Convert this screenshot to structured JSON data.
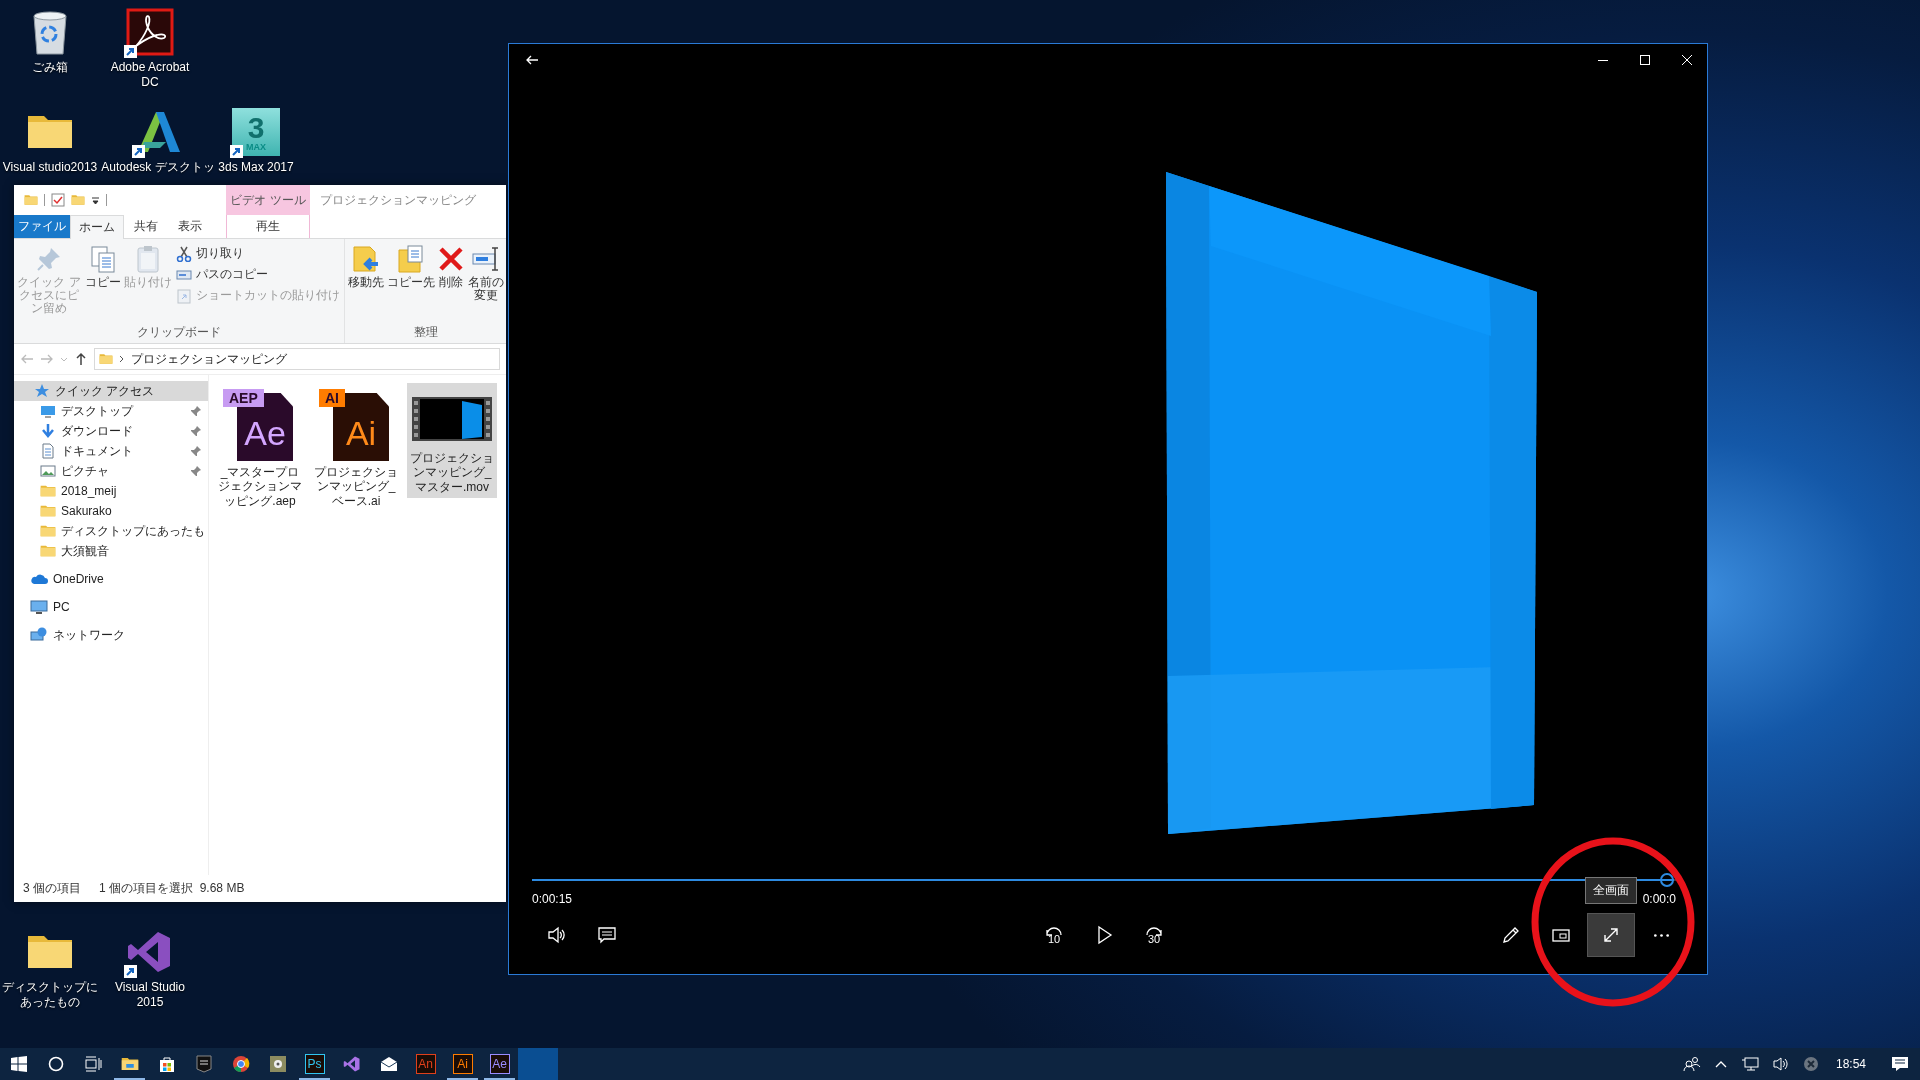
{
  "desktop_icons": [
    {
      "label": "ごみ箱",
      "kind": "recycle",
      "shortcut": false
    },
    {
      "label": "Adobe Acrobat DC",
      "kind": "acrobat",
      "shortcut": true
    },
    {
      "label": "Visual studio2013",
      "kind": "folder",
      "shortcut": false
    },
    {
      "label": "Autodesk デスクトッ",
      "kind": "autodesk",
      "shortcut": true
    },
    {
      "label": "3ds Max 2017",
      "kind": "max",
      "shortcut": true,
      "logo_text": "3",
      "logo_badge": "MAX"
    },
    {
      "label": "ディスクトップにあったもの",
      "kind": "folder",
      "shortcut": false
    },
    {
      "label": "Visual Studio 2015",
      "kind": "vs",
      "shortcut": true
    }
  ],
  "explorer": {
    "context_group": "ビデオ ツール",
    "title": "プロジェクションマッピング",
    "tabs": [
      {
        "label": "ファイル",
        "kind": "file",
        "selected": false
      },
      {
        "label": "ホーム",
        "kind": "tab",
        "selected": true
      },
      {
        "label": "共有",
        "kind": "tab",
        "selected": false
      },
      {
        "label": "表示",
        "kind": "tab",
        "selected": false
      },
      {
        "label": "再生",
        "kind": "context",
        "selected": false
      }
    ],
    "ribbon_groups": [
      {
        "label": "クリップボード",
        "commands": [
          {
            "label": "クイック アクセスにピン留め",
            "kind": "pin",
            "disabled": true
          },
          {
            "label": "コピー",
            "kind": "copy",
            "disabled": false
          },
          {
            "label": "貼り付け",
            "kind": "paste",
            "disabled": true
          },
          {
            "label": "切り取り",
            "kind": "cut",
            "disabled": false
          },
          {
            "label": "パスのコピー",
            "kind": "copy-path",
            "disabled": false
          },
          {
            "label": "ショートカットの貼り付け",
            "kind": "paste-shortcut",
            "disabled": true
          }
        ]
      },
      {
        "label": "整理",
        "commands": [
          {
            "label": "移動先",
            "kind": "move-to",
            "disabled": false
          },
          {
            "label": "コピー先",
            "kind": "copy-to",
            "disabled": false
          },
          {
            "label": "削除",
            "kind": "delete",
            "disabled": false
          },
          {
            "label": "名前の変更",
            "kind": "rename",
            "disabled": false
          }
        ]
      }
    ],
    "breadcrumb": "プロジェクションマッピング",
    "navigation": [
      {
        "label": "クイック アクセス",
        "kind": "quick",
        "selected": true,
        "children": [
          {
            "label": "デスクトップ",
            "kind": "desktop",
            "pinned": true,
            "selected": false
          },
          {
            "label": "ダウンロード",
            "kind": "download",
            "pinned": true,
            "selected": false
          },
          {
            "label": "ドキュメント",
            "kind": "document",
            "pinned": true,
            "selected": false
          },
          {
            "label": "ピクチャ",
            "kind": "picture",
            "pinned": true,
            "selected": false
          },
          {
            "label": "2018_meij",
            "kind": "folder",
            "pinned": false,
            "selected": false
          },
          {
            "label": "Sakurako",
            "kind": "folder",
            "pinned": false,
            "selected": false
          },
          {
            "label": "ディスクトップにあったも",
            "kind": "folder",
            "pinned": false,
            "selected": false
          },
          {
            "label": "大須観音",
            "kind": "folder",
            "pinned": false,
            "selected": false
          }
        ]
      },
      {
        "label": "OneDrive",
        "kind": "onedrive",
        "selected": false
      },
      {
        "label": "PC",
        "kind": "pc",
        "selected": false
      },
      {
        "label": "ネットワーク",
        "kind": "network",
        "selected": false
      }
    ],
    "files": [
      {
        "name": "_マスタープロジェクションマッピング.aep",
        "kind": "aep",
        "badge": "AEP",
        "glyph": "Ae",
        "selected": false
      },
      {
        "name": "プロジェクションマッピング_ベース.ai",
        "kind": "ai",
        "badge": "AI",
        "glyph": "Ai",
        "selected": false
      },
      {
        "name": "プロジェクションマッピング_マスター.mov",
        "kind": "video",
        "selected": true
      }
    ],
    "status": {
      "count": "3 個の項目",
      "selection": "1 個の項目を選択  9.68 MB"
    }
  },
  "player": {
    "seek": {
      "level": 0.998
    },
    "elapsed": "0:00:15",
    "remaining": "0:00:0",
    "controls_left": [
      {
        "kind": "volume",
        "hovered": false
      },
      {
        "kind": "captions",
        "hovered": false
      }
    ],
    "controls_center": [
      {
        "kind": "replay",
        "label": "10",
        "hovered": false
      },
      {
        "kind": "play",
        "hovered": false
      },
      {
        "kind": "forward",
        "label": "30",
        "hovered": false
      }
    ],
    "controls_right": [
      {
        "kind": "edit",
        "hovered": false
      },
      {
        "kind": "mini-view",
        "hovered": false
      },
      {
        "kind": "fullscreen",
        "hovered": true,
        "tooltip": "全画面"
      },
      {
        "kind": "more",
        "hovered": false
      }
    ]
  },
  "taskbar": {
    "apps": [
      {
        "kind": "explorer",
        "running": true,
        "active": false
      },
      {
        "kind": "store",
        "running": false,
        "active": false
      },
      {
        "kind": "epic",
        "running": false,
        "active": false
      },
      {
        "kind": "chrome",
        "running": false,
        "active": false
      },
      {
        "kind": "media",
        "running": false,
        "active": false
      },
      {
        "kind": "badge",
        "label": "Ps",
        "color": "#31c5f0",
        "running": true,
        "active": false
      },
      {
        "kind": "vs",
        "running": false,
        "active": false
      },
      {
        "kind": "mail",
        "running": false,
        "active": false
      },
      {
        "kind": "badge",
        "label": "An",
        "color": "#e0401c",
        "running": false,
        "active": false
      },
      {
        "kind": "badge",
        "label": "Ai",
        "color": "#ff7c00",
        "running": true,
        "active": false
      },
      {
        "kind": "badge",
        "label": "Ae",
        "color": "#9a8cff",
        "running": true,
        "active": false
      },
      {
        "kind": "blank",
        "running": false,
        "active": true
      }
    ],
    "clock": "18:54"
  }
}
